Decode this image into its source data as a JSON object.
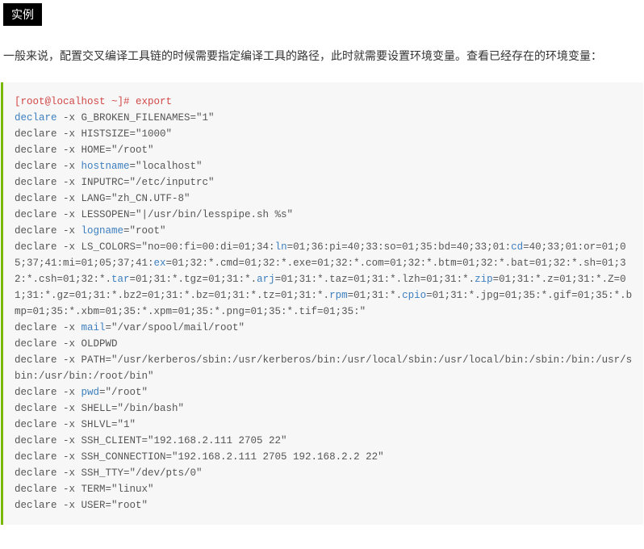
{
  "badge": "实例",
  "intro": "一般来说，配置交叉编译工具链的时候需要指定编译工具的路径，此时就需要设置环境变量。查看已经存在的环境变量：",
  "code": {
    "tokens": [
      {
        "t": "[root@localhost ~]# export",
        "c": "red"
      },
      {
        "t": "\n"
      },
      {
        "t": "declare",
        "c": "blue"
      },
      {
        "t": " -x G_BROKEN_FILENAMES=\"1\""
      },
      {
        "t": "\n"
      },
      {
        "t": "declare -x HISTSIZE=\"1000\""
      },
      {
        "t": "\n"
      },
      {
        "t": "declare -x HOME=\"/root\""
      },
      {
        "t": "\n"
      },
      {
        "t": "declare -x "
      },
      {
        "t": "hostname",
        "c": "blue"
      },
      {
        "t": "=\"localhost\""
      },
      {
        "t": "\n"
      },
      {
        "t": "declare -x INPUTRC=\"/etc/inputrc\""
      },
      {
        "t": "\n"
      },
      {
        "t": "declare -x LANG=\"zh_CN.UTF-8\""
      },
      {
        "t": "\n"
      },
      {
        "t": "declare -x LESSOPEN=\"|/usr/bin/lesspipe.sh %s\""
      },
      {
        "t": "\n"
      },
      {
        "t": "declare -x "
      },
      {
        "t": "logname",
        "c": "blue"
      },
      {
        "t": "=\"root\""
      },
      {
        "t": "\n"
      },
      {
        "t": "declare -x LS_COLORS=\"no=00:fi=00:di=01;34:"
      },
      {
        "t": "ln",
        "c": "blue"
      },
      {
        "t": "=01;36:pi=40;33:so=01;35:bd=40;33;01:"
      },
      {
        "t": "cd",
        "c": "blue"
      },
      {
        "t": "=40;33;01:or=01;05;37;41:mi=01;05;37;41:"
      },
      {
        "t": "ex",
        "c": "blue"
      },
      {
        "t": "=01;32:*.cmd=01;32:*.exe=01;32:*.com=01;32:*.btm=01;32:*.bat=01;32:*.sh=01;32:*.csh=01;32:*."
      },
      {
        "t": "tar",
        "c": "blue"
      },
      {
        "t": "=01;31:*.tgz=01;31:*."
      },
      {
        "t": "arj",
        "c": "blue"
      },
      {
        "t": "=01;31:*.taz=01;31:*.lzh=01;31:*."
      },
      {
        "t": "zip",
        "c": "blue"
      },
      {
        "t": "=01;31:*.z=01;31:*.Z=01;31:*.gz=01;31:*.bz2=01;31:*.bz=01;31:*.tz=01;31:*."
      },
      {
        "t": "rpm",
        "c": "blue"
      },
      {
        "t": "=01;31:*."
      },
      {
        "t": "cpio",
        "c": "blue"
      },
      {
        "t": "=01;31:*.jpg=01;35:*.gif=01;35:*.bmp=01;35:*.xbm=01;35:*.xpm=01;35:*.png=01;35:*.tif=01;35:\""
      },
      {
        "t": "\n"
      },
      {
        "t": "declare -x "
      },
      {
        "t": "mail",
        "c": "blue"
      },
      {
        "t": "=\"/var/spool/mail/root\""
      },
      {
        "t": "\n"
      },
      {
        "t": "declare -x OLDPWD"
      },
      {
        "t": "\n"
      },
      {
        "t": "declare -x PATH=\"/usr/kerberos/sbin:/usr/kerberos/bin:/usr/local/sbin:/usr/local/bin:/sbin:/bin:/usr/sbin:/usr/bin:/root/bin\""
      },
      {
        "t": "\n"
      },
      {
        "t": "declare -x "
      },
      {
        "t": "pwd",
        "c": "blue"
      },
      {
        "t": "=\"/root\""
      },
      {
        "t": "\n"
      },
      {
        "t": "declare -x SHELL=\"/bin/bash\""
      },
      {
        "t": "\n"
      },
      {
        "t": "declare -x SHLVL=\"1\""
      },
      {
        "t": "\n"
      },
      {
        "t": "declare -x SSH_CLIENT=\"192.168.2.111 2705 22\""
      },
      {
        "t": "\n"
      },
      {
        "t": "declare -x SSH_CONNECTION=\"192.168.2.111 2705 192.168.2.2 22\""
      },
      {
        "t": "\n"
      },
      {
        "t": "declare -x SSH_TTY=\"/dev/pts/0\""
      },
      {
        "t": "\n"
      },
      {
        "t": "declare -x TERM=\"linux\""
      },
      {
        "t": "\n"
      },
      {
        "t": "declare -x USER=\"root\""
      }
    ]
  }
}
